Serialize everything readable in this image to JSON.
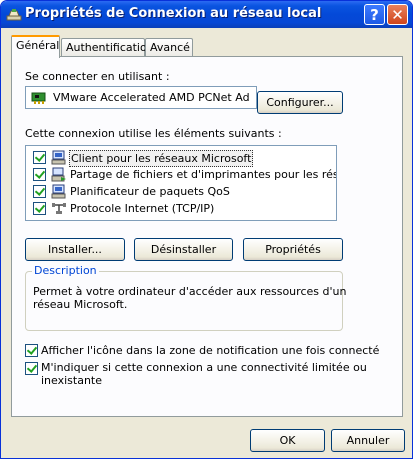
{
  "window": {
    "title": "Propriétés de Connexion au réseau local",
    "help_glyph": "?",
    "close_glyph": "✕"
  },
  "tabs": [
    {
      "label": "Général",
      "active": true
    },
    {
      "label": "Authentification",
      "active": false
    },
    {
      "label": "Avancé",
      "active": false
    }
  ],
  "general": {
    "connect_using_label": "Se connecter en utilisant :",
    "adapter_name": "VMware Accelerated AMD PCNet Ad",
    "configure_button": "Configurer...",
    "components_label": "Cette connexion utilise les éléments suivants :",
    "components": [
      {
        "label": "Client pour les réseaux Microsoft",
        "checked": true,
        "selected": true,
        "icon": "network-client-icon"
      },
      {
        "label": "Partage de fichiers et d'imprimantes pour les réseaux Mi...",
        "checked": true,
        "selected": false,
        "icon": "file-printer-sharing-icon"
      },
      {
        "label": "Planificateur de paquets QoS",
        "checked": true,
        "selected": false,
        "icon": "qos-scheduler-icon"
      },
      {
        "label": "Protocole Internet (TCP/IP)",
        "checked": true,
        "selected": false,
        "icon": "network-protocol-icon"
      }
    ],
    "install_button": "Installer...",
    "uninstall_button": "Désinstaller",
    "properties_button": "Propriétés",
    "description_title": "Description",
    "description_text_line1": "Permet à votre ordinateur d'accéder aux ressources d'un",
    "description_text_line2": "réseau Microsoft.",
    "show_icon_checkbox": {
      "label": "Afficher l'icône dans la zone de notification une fois connecté",
      "checked": true
    },
    "notify_checkbox": {
      "label_line1": "M'indiquer si cette connexion a une connectivité limitée ou",
      "label_line2": "inexistante",
      "checked": true
    }
  },
  "footer": {
    "ok_button": "OK",
    "cancel_button": "Annuler"
  }
}
